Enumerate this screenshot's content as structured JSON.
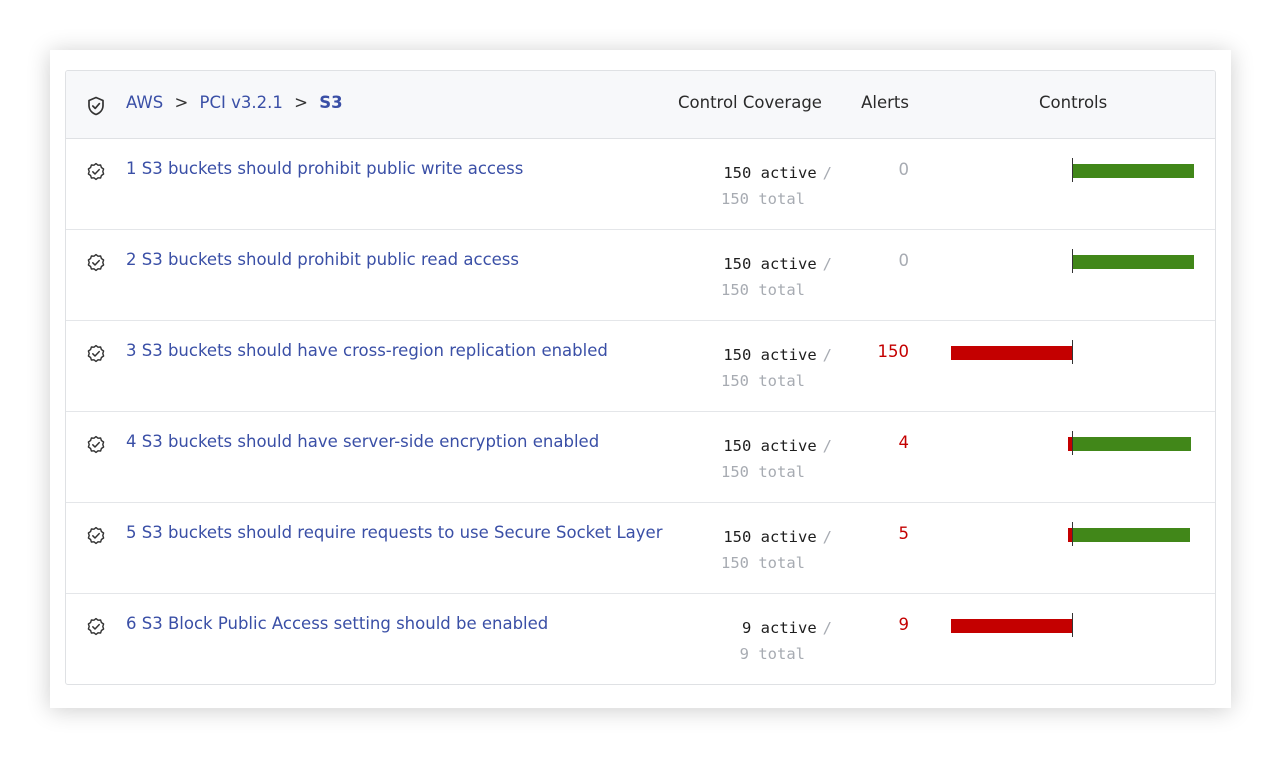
{
  "header": {
    "breadcrumb": [
      {
        "label": "AWS"
      },
      {
        "label": "PCI v3.2.1"
      },
      {
        "label": "S3"
      }
    ],
    "separator": ">",
    "columns": {
      "coverage": "Control Coverage",
      "alerts": "Alerts",
      "controls": "Controls"
    }
  },
  "colors": {
    "link": "#3a4fa6",
    "alarm": "#c40000",
    "ok": "#418719",
    "muted": "#a7abb2"
  },
  "controls": [
    {
      "title": "1 S3 buckets should prohibit public write access",
      "active": "150 active",
      "total": "150 total",
      "alerts": "0",
      "alerts_status": "ok",
      "alarm_count": 0,
      "ok_count": 150,
      "total_count": 150
    },
    {
      "title": "2 S3 buckets should prohibit public read access",
      "active": "150 active",
      "total": "150 total",
      "alerts": "0",
      "alerts_status": "ok",
      "alarm_count": 0,
      "ok_count": 150,
      "total_count": 150
    },
    {
      "title": "3 S3 buckets should have cross-region replication enabled",
      "active": "150 active",
      "total": "150 total",
      "alerts": "150",
      "alerts_status": "alarm",
      "alarm_count": 150,
      "ok_count": 0,
      "total_count": 150
    },
    {
      "title": "4 S3 buckets should have server-side encryption enabled",
      "active": "150 active",
      "total": "150 total",
      "alerts": "4",
      "alerts_status": "alarm",
      "alarm_count": 4,
      "ok_count": 146,
      "total_count": 150
    },
    {
      "title": "5 S3 buckets should require requests to use Secure Socket Layer",
      "active": "150 active",
      "total": "150 total",
      "alerts": "5",
      "alerts_status": "alarm",
      "alarm_count": 5,
      "ok_count": 145,
      "total_count": 150
    },
    {
      "title": "6 S3 Block Public Access setting should be enabled",
      "active": "9 active",
      "total": "9 total",
      "alerts": "9",
      "alerts_status": "alarm",
      "alarm_count": 9,
      "ok_count": 0,
      "total_count": 9
    }
  ]
}
